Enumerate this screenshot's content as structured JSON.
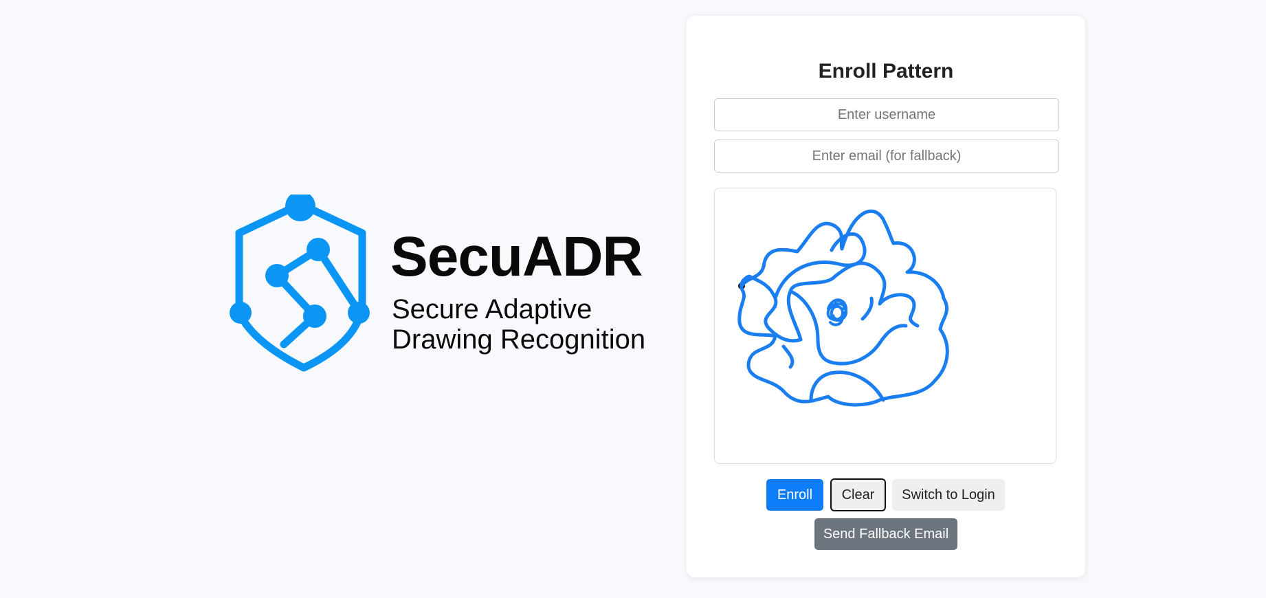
{
  "brand": {
    "name": "SecuADR",
    "tagline_line1": "Secure Adaptive",
    "tagline_line2": "Drawing Recognition",
    "accent_color": "#0b96f5"
  },
  "enroll_form": {
    "title": "Enroll Pattern",
    "username_placeholder": "Enter username",
    "email_placeholder": "Enter email (for fallback)",
    "username_value": "",
    "email_value": "",
    "stroke_color": "#1a7ef0"
  },
  "buttons": {
    "enroll_label": "Enroll",
    "clear_label": "Clear",
    "switch_label": "Switch to Login",
    "fallback_label": "Send Fallback Email"
  },
  "colors": {
    "primary": "#0d7df8",
    "secondary": "#6c757d",
    "background": "#f7f9fc"
  }
}
